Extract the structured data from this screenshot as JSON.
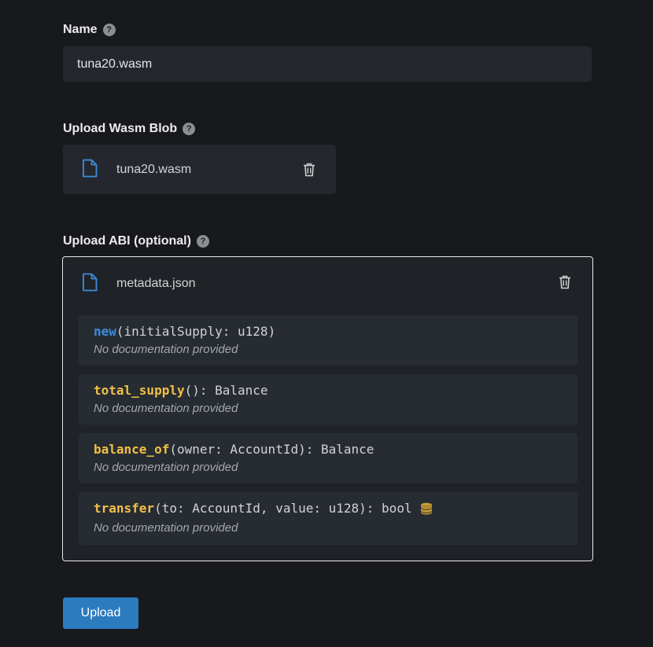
{
  "name_field": {
    "label": "Name",
    "value": "tuna20.wasm",
    "help_icon": "question-circle-icon"
  },
  "wasm_upload": {
    "label": "Upload Wasm Blob",
    "file_name": "tuna20.wasm",
    "file_icon": "file-icon",
    "remove_icon": "trash-icon"
  },
  "abi_upload": {
    "label": "Upload ABI (optional)",
    "file_name": "metadata.json",
    "messages": [
      {
        "name": "new",
        "args": "(initialSupply: u128)",
        "returns": "",
        "doc": "No documentation provided"
      },
      {
        "name": "total_supply",
        "args": "()",
        "returns": ": Balance",
        "doc": "No documentation provided"
      },
      {
        "name": "balance_of",
        "args": "(owner: AccountId)",
        "returns": ": Balance",
        "doc": "No documentation provided"
      },
      {
        "name": "transfer",
        "args": "(to: AccountId, value: u128)",
        "returns": ": bool",
        "doc": "No documentation provided",
        "mutates_icon": "database-icon"
      }
    ]
  },
  "upload_button": {
    "label": "Upload"
  },
  "colors": {
    "background": "#18191d",
    "input_bg": "#24282e",
    "constructor": "#3e8cdc",
    "message": "#f1c045",
    "coin": "#c9a13a",
    "button": "#2d7bbf"
  }
}
